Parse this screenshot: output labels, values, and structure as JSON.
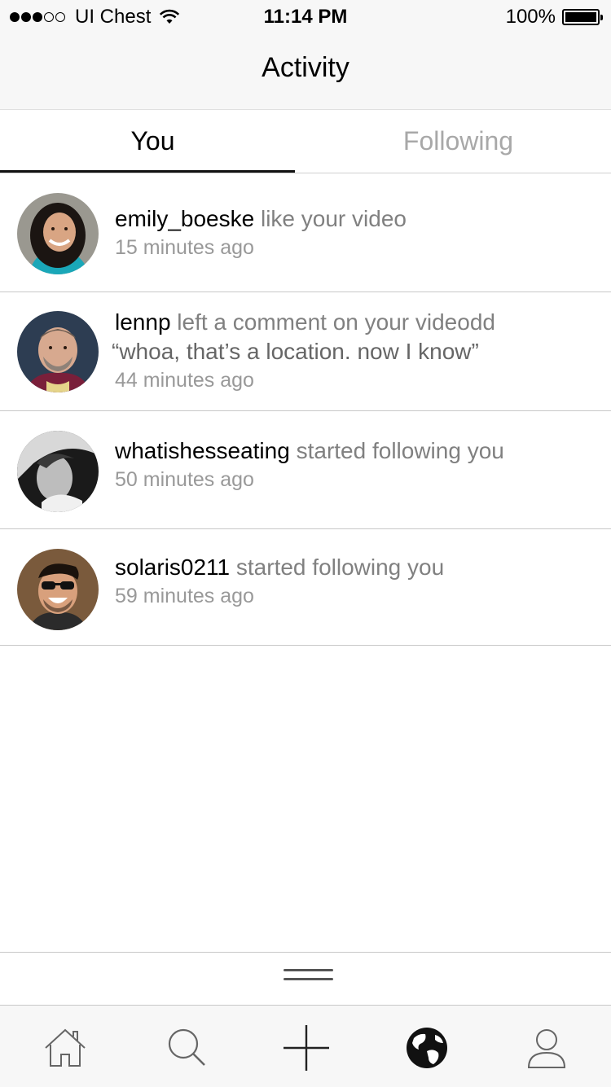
{
  "status_bar": {
    "carrier": "UI Chest",
    "time": "11:14 PM",
    "battery": "100%",
    "signal_icon": "signal-dots-icon",
    "wifi_icon": "wifi-icon",
    "battery_icon": "battery-icon"
  },
  "nav": {
    "title": "Activity"
  },
  "tabs": [
    {
      "label": "You",
      "active": true
    },
    {
      "label": "Following",
      "active": false
    }
  ],
  "activity": [
    {
      "user": "emily_boeske",
      "action": "like your video",
      "comment": "",
      "time": "15 minutes ago"
    },
    {
      "user": "lennp",
      "action": "left a comment on your videodd",
      "comment": "“whoa, that’s a location. now I know”",
      "time": "44 minutes ago"
    },
    {
      "user": "whatishesseating",
      "action": "started following you",
      "comment": "",
      "time": "50 minutes ago"
    },
    {
      "user": "solaris0211",
      "action": "started following you",
      "comment": "",
      "time": "59 minutes ago"
    }
  ],
  "tab_bar": [
    {
      "icon": "home-icon"
    },
    {
      "icon": "search-icon"
    },
    {
      "icon": "plus-icon"
    },
    {
      "icon": "globe-icon",
      "active": true
    },
    {
      "icon": "profile-icon"
    }
  ],
  "colors": {
    "bar_background": "#f7f7f7",
    "inactive_tab_text": "#a8a8a8",
    "secondary_text": "#808080",
    "time_text": "#999999",
    "divider": "#c8c8c8"
  }
}
